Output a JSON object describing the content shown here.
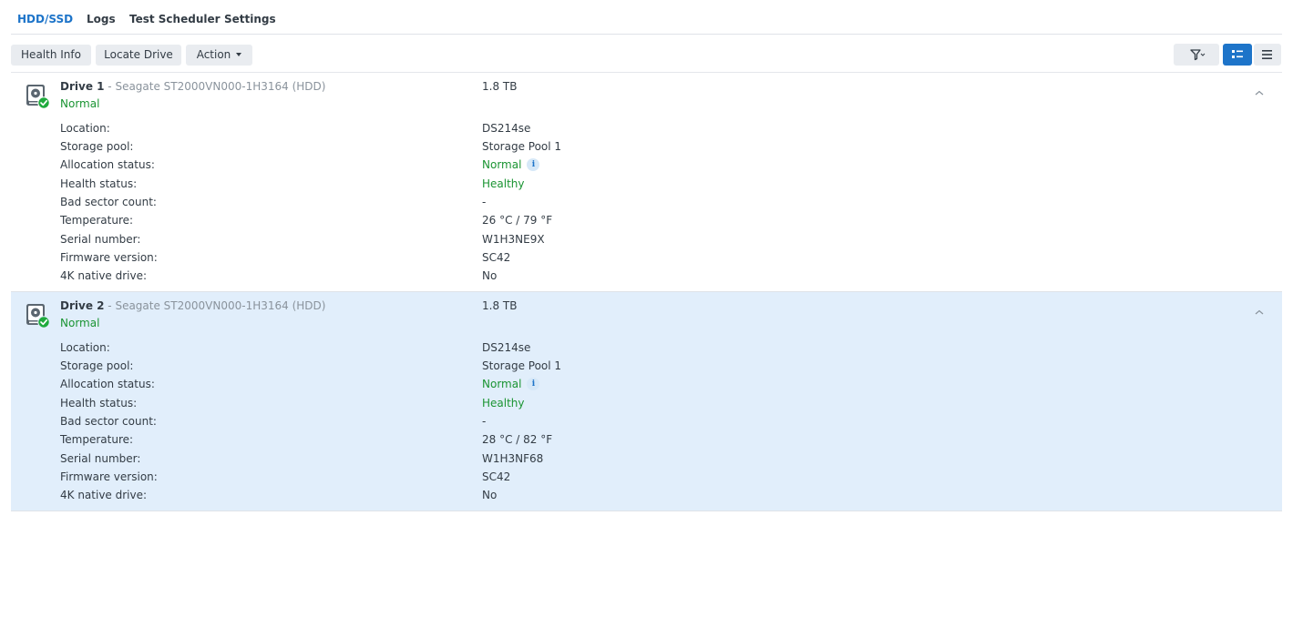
{
  "tabs": [
    {
      "label": "HDD/SSD",
      "active": true
    },
    {
      "label": "Logs"
    },
    {
      "label": "Test Scheduler"
    },
    {
      "label": "Settings"
    }
  ],
  "toolbar": {
    "health_info": "Health Info",
    "locate_drive": "Locate Drive",
    "action": "Action",
    "icons": [
      "filter-icon",
      "card-view-icon",
      "list-view-icon"
    ],
    "active_view": "card-view"
  },
  "labels": {
    "location": "Location:",
    "storage_pool": "Storage pool:",
    "allocation_status": "Allocation status:",
    "health_status": "Health status:",
    "bad_sector_count": "Bad sector count:",
    "temperature": "Temperature:",
    "serial_number": "Serial number:",
    "firmware_version": "Firmware version:",
    "native_4k": "4K native drive:"
  },
  "drives": [
    {
      "name": "Drive 1",
      "separator": " - ",
      "model": "Seagate ST2000VN000-1H3164 (HDD)",
      "status": "Normal",
      "capacity": "1.8 TB",
      "selected": false,
      "location": "DS214se",
      "storage_pool": "Storage Pool 1",
      "allocation_status": "Normal",
      "info_glyph": "i",
      "health_status": "Healthy",
      "bad_sector_count": "-",
      "temperature": "26 °C / 79 °F",
      "serial_number": "W1H3NE9X",
      "firmware_version": "SC42",
      "native_4k": "No"
    },
    {
      "name": "Drive 2",
      "separator": " - ",
      "model": "Seagate ST2000VN000-1H3164 (HDD)",
      "status": "Normal",
      "capacity": "1.8 TB",
      "selected": true,
      "location": "DS214se",
      "storage_pool": "Storage Pool 1",
      "allocation_status": "Normal",
      "info_glyph": "i",
      "health_status": "Healthy",
      "bad_sector_count": "-",
      "temperature": "28 °C / 82 °F",
      "serial_number": "W1H3NF68",
      "firmware_version": "SC42",
      "native_4k": "No"
    }
  ],
  "colors": {
    "accent": "#1d74c9",
    "status_green": "#1a9432",
    "selected_row": "#e1eefb"
  }
}
